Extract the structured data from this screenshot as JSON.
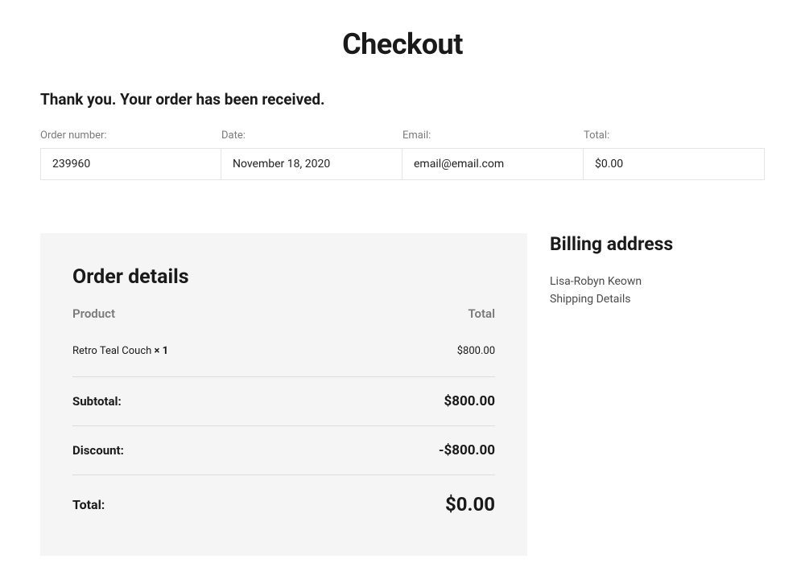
{
  "page": {
    "title": "Checkout",
    "thank_you": "Thank you. Your order has been received."
  },
  "summary": {
    "order_number": {
      "label": "Order number:",
      "value": "239960"
    },
    "date": {
      "label": "Date:",
      "value": "November 18, 2020"
    },
    "email": {
      "label": "Email:",
      "value": "email@email.com"
    },
    "total": {
      "label": "Total:",
      "value": "$0.00"
    }
  },
  "order_details": {
    "heading": "Order details",
    "columns": {
      "product": "Product",
      "total": "Total"
    },
    "items": [
      {
        "name": "Retro Teal Couch",
        "qty_marker": "× 1",
        "total": "$800.00"
      }
    ],
    "subtotal": {
      "label": "Subtotal:",
      "value": "$800.00"
    },
    "discount": {
      "label": "Discount:",
      "value": "-$800.00"
    },
    "total": {
      "label": "Total:",
      "value": "$0.00"
    }
  },
  "billing": {
    "heading": "Billing address",
    "name": "Lisa-Robyn Keown",
    "line2": "Shipping Details"
  }
}
